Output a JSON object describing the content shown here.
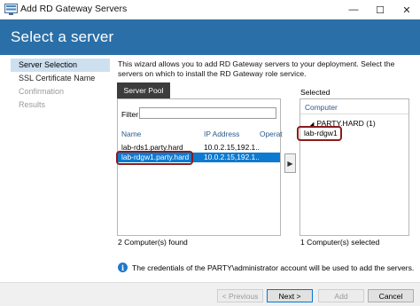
{
  "window": {
    "title": "Add RD Gateway Servers",
    "controls": {
      "minimize": "—",
      "maximize": "☐",
      "close": "✕"
    }
  },
  "header": {
    "title": "Select a server",
    "color": "#2a6fa8"
  },
  "steps": [
    {
      "label": "Server Selection",
      "state": "active"
    },
    {
      "label": "SSL Certificate Name",
      "state": "enabled"
    },
    {
      "label": "Confirmation",
      "state": "disabled"
    },
    {
      "label": "Results",
      "state": "disabled"
    }
  ],
  "description": "This wizard allows you to add RD Gateway servers to your deployment. Select the servers on which to install the RD Gateway role service.",
  "server_pool": {
    "tab_label": "Server Pool",
    "filter_label": "Filter:",
    "filter_value": "",
    "columns": [
      "Name",
      "IP Address",
      "Operat"
    ],
    "rows": [
      {
        "name": "lab-rds1.party.hard",
        "ip": "10.0.2.15,192.1...",
        "op": "",
        "selected": false
      },
      {
        "name": "lab-rdgw1.party.hard",
        "ip": "10.0.2.15,192.1...",
        "op": "",
        "selected": true
      }
    ],
    "count_text": "2 Computer(s) found"
  },
  "add_arrow": "▶",
  "selected": {
    "label": "Selected",
    "column": "Computer",
    "group": {
      "toggle": "◢",
      "label": "PARTY.HARD (1)"
    },
    "items": [
      "lab-rdgw1"
    ],
    "count_text": "1 Computer(s) selected"
  },
  "info": {
    "icon": "i",
    "text": "The credentials of the PARTY\\administrator account will be used to add the servers."
  },
  "footer": {
    "previous": "< Previous",
    "next": "Next >",
    "add": "Add",
    "cancel": "Cancel"
  },
  "colors": {
    "accent": "#0d7ad0",
    "highlight": "#8b1c1c"
  }
}
